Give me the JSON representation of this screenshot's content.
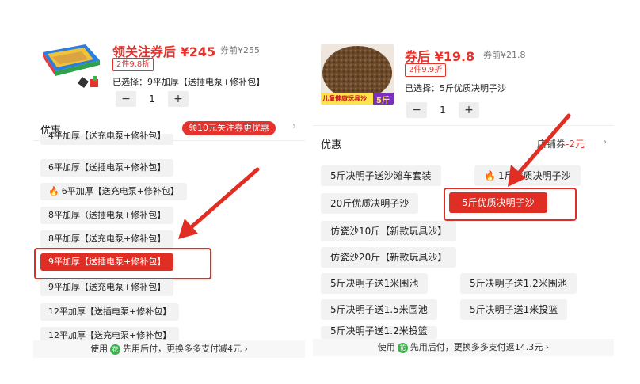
{
  "left": {
    "price": "领关注券后 ¥245",
    "original_price": "券前¥255",
    "badge": "2件9.8折",
    "selected_label": "已选择：",
    "selected_value": "9平加厚【送插电泵+修补包】",
    "quantity": "1",
    "minus": "−",
    "plus": "+",
    "section_title": "优惠",
    "coupon_pill": "领10元关注券更优惠",
    "chevron": "›",
    "options": [
      "4平加厚【送充电泵+修补包】",
      "6平加厚【送插电泵+修补包】",
      "6平加厚【送充电泵+修补包】",
      "8平加厚（送插电泵+修补包】",
      "8平加厚【送充电泵+修补包】",
      "9平加厚【送插电泵+修补包】",
      "9平加厚【送充电泵+修补包】",
      "12平加厚【送插电泵+修补包】",
      "12平加厚【送充电泵+修补包】"
    ],
    "footer": {
      "prefix": "使用",
      "icon_text": "花",
      "text": "先用后付，更换多多支付减4元",
      "chevron": "›"
    }
  },
  "right": {
    "price": "券后 ¥19.8",
    "original_price": "券前¥21.8",
    "badge": "2件9.9折",
    "selected_label": "已选择：",
    "selected_value": "5斤优质决明子沙",
    "quantity": "1",
    "minus": "−",
    "plus": "+",
    "product_banner": "儿童健康玩具沙",
    "product_weight": "5斤",
    "section_title": "优惠",
    "coupon_text_prefix": "店铺券",
    "coupon_text_amount": "-2元",
    "chevron": "›",
    "options": [
      "5斤决明子送沙滩车套装",
      "1斤优质决明子沙",
      "20斤优质决明子沙",
      "5斤优质决明子沙",
      "仿瓷沙10斤【新款玩具沙】",
      "仿瓷沙20斤【新款玩具沙】",
      "5斤决明子送1米围池",
      "5斤决明子送1.2米围池",
      "5斤决明子送1.5米围池",
      "5斤决明子送1米投篮",
      "5斤决明子送1.2米投篮"
    ],
    "footer": {
      "prefix": "使用",
      "icon_text": "花",
      "text": "先用后付，更换多多支付返14.3元",
      "chevron": "›"
    }
  },
  "colors": {
    "accent_red": "#e02e24",
    "price_red": "#e5322d",
    "option_bg": "#f2f2f2",
    "pay_green": "#3bb24a"
  },
  "icons": {
    "flame": "flame-icon",
    "chevron": "chevron-right-icon",
    "pay": "pay-later-icon",
    "arrow": "annotation-arrow"
  }
}
